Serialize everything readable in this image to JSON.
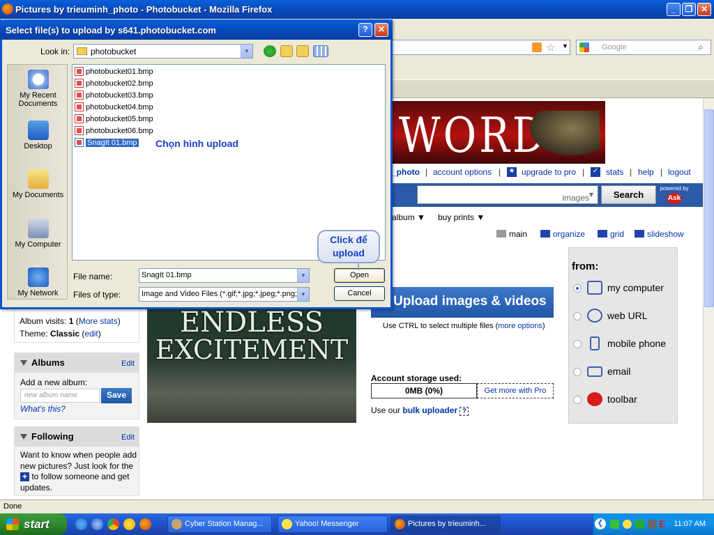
{
  "browser": {
    "title": "Pictures by trieuminh_photo - Photobucket - Mozilla Firefox",
    "search_placeholder": "Google",
    "status": "Done"
  },
  "site": {
    "banner_text": "WORD",
    "top_links": [
      "_photo",
      "account options",
      "upgrade to pro",
      "stats",
      "help",
      "logout"
    ],
    "search_scope": "images",
    "search_button": "Search",
    "powered_by": "powered by",
    "ask_logo": "Ask",
    "menu": [
      "album ▼",
      "buy prints ▼"
    ],
    "views": [
      "main",
      "organize",
      "grid",
      "slideshow"
    ]
  },
  "album_info": {
    "visits_label": "Album visits:",
    "visits_count": "1",
    "more_stats": "More stats",
    "theme_label": "Theme:",
    "theme_value": "Classic",
    "theme_edit": "edit"
  },
  "albums_box": {
    "title": "Albums",
    "edit": "Edit",
    "add_label": "Add a new album:",
    "input_placeholder": "new album name",
    "save": "Save",
    "whats_this": "What's this?"
  },
  "following_box": {
    "title": "Following",
    "edit": "Edit",
    "text1": "Want to know when people add new pictures? Just look for the",
    "text2": "to follow someone and get updates."
  },
  "movie_ad": {
    "line1": "ENDLESS",
    "line2": "EXCITEMENT"
  },
  "upload": {
    "button": "Upload images & videos",
    "hint": "Use CTRL to select multiple files (",
    "hint_link": "more options",
    "hint_end": ")",
    "storage_label": "Account storage used:",
    "storage_value": "0MB (0%)",
    "get_more": "Get more with Pro",
    "bulk_prefix": "Use our",
    "bulk_link": "bulk uploader",
    "help_q": "?"
  },
  "from": {
    "title": "from:",
    "options": [
      "my computer",
      "web URL",
      "mobile phone",
      "email",
      "toolbar"
    ],
    "selected": "my computer"
  },
  "dialog": {
    "title": "Select file(s) to upload by s641.photobucket.com",
    "look_in_label": "Look in:",
    "look_in_value": "photobucket",
    "places": [
      "My Recent Documents",
      "Desktop",
      "My Documents",
      "My Computer",
      "My Network"
    ],
    "files": [
      "photobucket01.bmp",
      "photobucket02.bmp",
      "photobucket03.bmp",
      "photobucket04.bmp",
      "photobucket05.bmp",
      "photobucket06.bmp",
      "SnagIt 01.bmp"
    ],
    "selected_file": "SnagIt 01.bmp",
    "file_name_label": "File name:",
    "file_name_value": "SnagIt 01.bmp",
    "file_type_label": "Files of type:",
    "file_type_value": "Image and Video Files (*.gif;*.jpg;*.jpeg;*.png;*.l",
    "open": "Open",
    "cancel": "Cancel",
    "annotation_select": "Chọn hình upload",
    "annotation_click": "Click để upload"
  },
  "taskbar": {
    "start": "start",
    "tasks": [
      "Cyber Station Manag...",
      "Yahoo! Messenger",
      "Pictures by trieuminh..."
    ],
    "clock": "11:07 AM"
  },
  "colors": {
    "xp_blue": "#0a5fd8",
    "link": "#0033aa",
    "annotation": "#1a3fc7",
    "upload_button": "#1e56a8"
  }
}
